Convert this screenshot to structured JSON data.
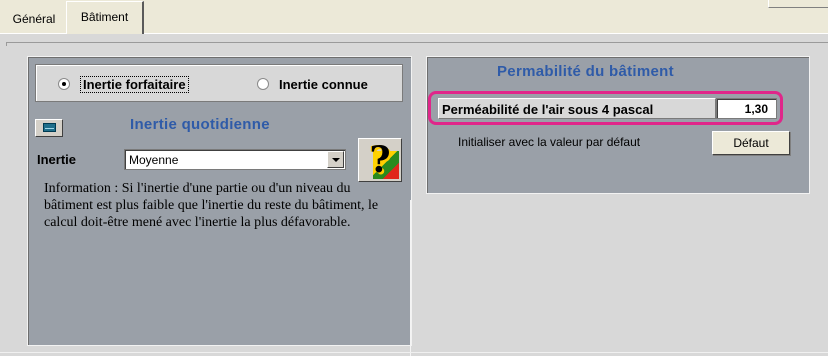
{
  "tabs": [
    {
      "label": "Général"
    },
    {
      "label": "Bâtiment"
    }
  ],
  "radio_options": [
    {
      "label": "Inertie forfaitaire",
      "checked": true
    },
    {
      "label": "Inertie connue",
      "checked": false
    }
  ],
  "left_section": {
    "title": "Inertie quotidienne",
    "field_label": "Inertie",
    "select_value": "Moyenne",
    "info_text": "Information : Si l'inertie d'une partie ou d'un niveau du bâtiment est plus faible que l'inertie du reste du bâtiment, le calcul doit-être mené avec l'inertie la plus défavorable."
  },
  "right_section": {
    "title": "Permabilité du bâtiment",
    "field_label": "Perméabilité de l'air sous 4 pascal",
    "field_value": "1,30",
    "init_text": "Initialiser avec la valeur par défaut",
    "default_button": "Défaut"
  },
  "colors": {
    "title_blue": "#2f5ba8",
    "highlight_pink": "#e0268a",
    "group_bg": "#9aa0a8"
  }
}
